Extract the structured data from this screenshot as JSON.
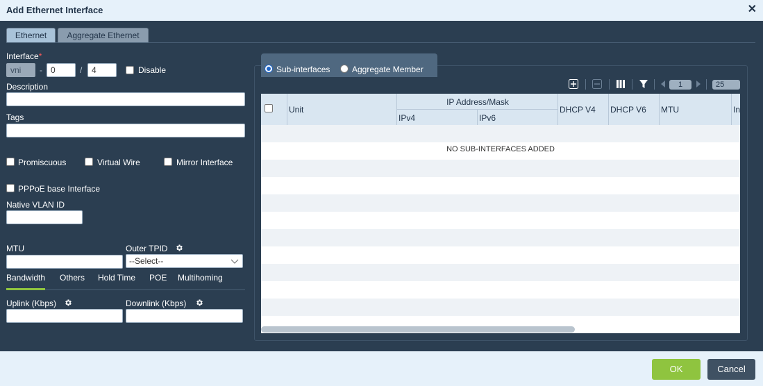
{
  "dialog": {
    "title": "Add Ethernet Interface"
  },
  "tabs": [
    {
      "label": "Ethernet"
    },
    {
      "label": "Aggregate Ethernet"
    }
  ],
  "form": {
    "interface_label": "Interface",
    "required_mark": "*",
    "interface_prefix": "vni",
    "dash": "-",
    "slot_value": "0",
    "slash": "/",
    "port_value": "4",
    "disable_label": "Disable",
    "description_label": "Description",
    "description_value": "",
    "tags_label": "Tags",
    "tags_value": "",
    "promiscuous_label": "Promiscuous",
    "virtual_wire_label": "Virtual Wire",
    "mirror_interface_label": "Mirror Interface",
    "pppoe_label": "PPPoE base Interface",
    "native_vlan_label": "Native VLAN ID",
    "native_vlan_value": "",
    "mtu_label": "MTU",
    "mtu_value": "",
    "outer_tpid_label": "Outer TPID",
    "outer_tpid_value": "--Select--"
  },
  "subtabs": [
    {
      "label": "Bandwidth"
    },
    {
      "label": "Others"
    },
    {
      "label": "Hold Time"
    },
    {
      "label": "POE"
    },
    {
      "label": "Multihoming"
    }
  ],
  "bandwidth": {
    "uplink_label": "Uplink (Kbps)",
    "uplink_value": "",
    "downlink_label": "Downlink (Kbps)",
    "downlink_value": ""
  },
  "right_panel": {
    "radio_sub": "Sub-interfaces",
    "radio_agg": "Aggregate Member",
    "page_number": "1",
    "page_size": "25",
    "columns": {
      "unit": "Unit",
      "ip": "IP Address/Mask",
      "ipv4": "IPv4",
      "ipv6": "IPv6",
      "dhcp4": "DHCP V4",
      "dhcp6": "DHCP V6",
      "mtu": "MTU",
      "truncated": "In"
    },
    "empty_text": "NO SUB-INTERFACES ADDED"
  },
  "footer": {
    "ok": "OK",
    "cancel": "Cancel"
  }
}
